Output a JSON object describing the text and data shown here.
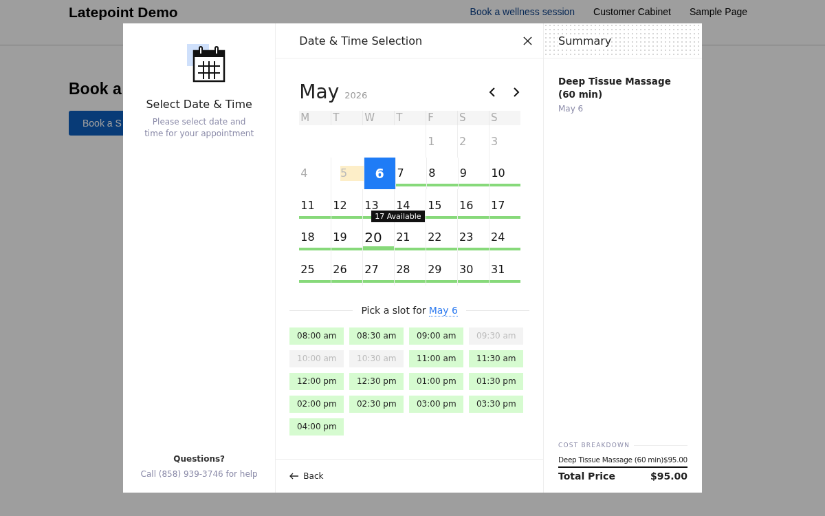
{
  "page": {
    "site_title": "Latepoint Demo",
    "nav": [
      {
        "label": "Book a wellness session",
        "selected": true
      },
      {
        "label": "Customer Cabinet",
        "selected": false
      },
      {
        "label": "Sample Page",
        "selected": false
      }
    ],
    "heading": "Book a",
    "button": "Book a S"
  },
  "modal": {
    "side": {
      "title": "Select Date & Time",
      "description": "Please select date and time for your appointment",
      "help_title": "Questions?",
      "help_text": "Call (858) 939-3746 for help"
    },
    "title": "Date & Time Selection",
    "calendar": {
      "month": "May",
      "year": "2026",
      "weekdays": [
        "M",
        "T",
        "W",
        "T",
        "F",
        "S",
        "S"
      ],
      "weeks": [
        [
          {
            "label": "1",
            "kind": "past",
            "selected": false
          },
          {
            "label": "2",
            "kind": "past",
            "selected": false
          },
          {
            "label": "3",
            "kind": "past",
            "selected": false
          }
        ],
        [
          {
            "label": "4",
            "kind": "past",
            "selected": false
          },
          {
            "label": "5",
            "kind": "today",
            "selected": false
          },
          {
            "label": "6",
            "kind": "available",
            "selected": true
          },
          {
            "label": "7",
            "kind": "available",
            "selected": false
          },
          {
            "label": "8",
            "kind": "available",
            "selected": false
          },
          {
            "label": "9",
            "kind": "available",
            "selected": false
          },
          {
            "label": "10",
            "kind": "available",
            "selected": false
          }
        ],
        [
          {
            "label": "11",
            "kind": "available",
            "selected": false
          },
          {
            "label": "12",
            "kind": "available",
            "selected": false
          },
          {
            "label": "13",
            "kind": "available",
            "selected": false
          },
          {
            "label": "14",
            "kind": "available",
            "selected": false
          },
          {
            "label": "15",
            "kind": "available",
            "selected": false
          },
          {
            "label": "16",
            "kind": "available",
            "selected": false
          },
          {
            "label": "17",
            "kind": "available",
            "selected": false
          }
        ],
        [
          {
            "label": "18",
            "kind": "available",
            "selected": false
          },
          {
            "label": "19",
            "kind": "available",
            "selected": false
          },
          {
            "label": "20",
            "kind": "available",
            "selected": false,
            "tooltip": "17 Available"
          },
          {
            "label": "21",
            "kind": "available",
            "selected": false
          },
          {
            "label": "22",
            "kind": "available",
            "selected": false
          },
          {
            "label": "23",
            "kind": "available",
            "selected": false
          },
          {
            "label": "24",
            "kind": "available",
            "selected": false
          }
        ],
        [
          {
            "label": "25",
            "kind": "available",
            "selected": false
          },
          {
            "label": "26",
            "kind": "available",
            "selected": false
          },
          {
            "label": "27",
            "kind": "available",
            "selected": false
          },
          {
            "label": "28",
            "kind": "available",
            "selected": false
          },
          {
            "label": "29",
            "kind": "available",
            "selected": false
          },
          {
            "label": "30",
            "kind": "available",
            "selected": false
          },
          {
            "label": "31",
            "kind": "available",
            "selected": false
          }
        ]
      ]
    },
    "slots_title": {
      "prefix": "Pick a slot for",
      "date": "May 6"
    },
    "slots": [
      {
        "time": "08:00 am",
        "available": true
      },
      {
        "time": "08:30 am",
        "available": true
      },
      {
        "time": "09:00 am",
        "available": true
      },
      {
        "time": "09:30 am",
        "available": false
      },
      {
        "time": "10:00 am",
        "available": false
      },
      {
        "time": "10:30 am",
        "available": false
      },
      {
        "time": "11:00 am",
        "available": true
      },
      {
        "time": "11:30 am",
        "available": true
      },
      {
        "time": "12:00 pm",
        "available": true
      },
      {
        "time": "12:30 pm",
        "available": true
      },
      {
        "time": "01:00 pm",
        "available": true
      },
      {
        "time": "01:30 pm",
        "available": true
      },
      {
        "time": "02:00 pm",
        "available": true
      },
      {
        "time": "02:30 pm",
        "available": true
      },
      {
        "time": "03:00 pm",
        "available": true
      },
      {
        "time": "03:30 pm",
        "available": true
      },
      {
        "time": "04:00 pm",
        "available": true
      }
    ],
    "back": "Back",
    "summary": {
      "title": "Summary",
      "service": "Deep Tissue Massage (60 min)",
      "date": "May 6",
      "breakdown_title": "COST BREAKDOWN",
      "items": [
        {
          "name": "Deep Tissue Massage (60 min)",
          "price": "$95.00"
        }
      ],
      "total_label": "Total Price",
      "total_value": "$95.00"
    }
  }
}
